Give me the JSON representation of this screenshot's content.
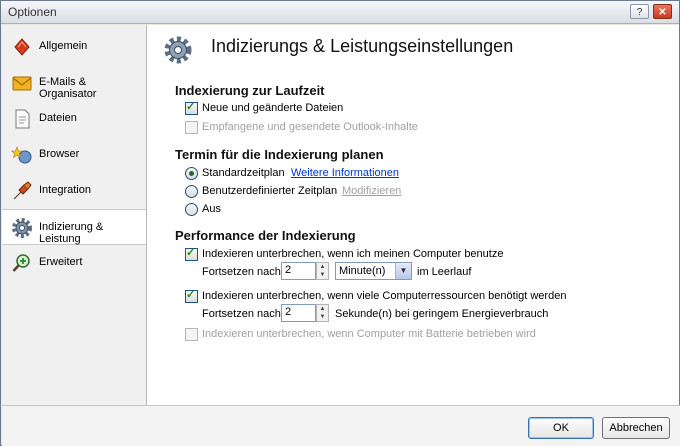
{
  "window": {
    "title": "Optionen",
    "help_label": "?",
    "close_label": "✕"
  },
  "sidebar": {
    "items": [
      {
        "label": "Allgemein",
        "icon": "general-icon",
        "active": false
      },
      {
        "label": "E-Mails & Organisator",
        "icon": "mail-icon",
        "active": false
      },
      {
        "label": "Dateien",
        "icon": "file-icon",
        "active": false
      },
      {
        "label": "Browser",
        "icon": "browser-icon",
        "active": false
      },
      {
        "label": "Integration",
        "icon": "integration-icon",
        "active": false
      },
      {
        "label": "Indizierung & Leistung",
        "icon": "gear-icon",
        "active": true
      },
      {
        "label": "Erweitert",
        "icon": "search-plus-icon",
        "active": false
      }
    ]
  },
  "main": {
    "title": "Indizierungs & Leistungseinstellungen",
    "runtime": {
      "heading": "Indexierung zur Laufzeit",
      "new_files_label": "Neue und geänderte Dateien",
      "new_files_checked": true,
      "outlook_label": "Empfangene und gesendete Outlook-Inhalte",
      "outlook_checked": false
    },
    "schedule": {
      "heading": "Termin für die Indexierung planen",
      "standard_label": "Standardzeitplan",
      "more_info_link": "Weitere Informationen",
      "custom_label": "Benutzerdefinierter Zeitplan",
      "modify_link": "Modifizieren",
      "off_label": "Aus",
      "selected": "standard"
    },
    "performance": {
      "heading": "Performance der Indexierung",
      "pause_use_label": "Indexieren unterbrechen, wenn ich meinen Computer benutze",
      "pause_use_checked": true,
      "resume_label_1": "Fortsetzen nach",
      "resume_value_1": "2",
      "unit_1": "Minute(n)",
      "idle_label": "im Leerlauf",
      "pause_resources_label": "Indexieren unterbrechen, wenn viele Computerressourcen benötigt werden",
      "pause_resources_checked": true,
      "resume_label_2": "Fortsetzen nach",
      "resume_value_2": "2",
      "seconds_label": "Sekunde(n) bei geringem Energieverbrauch",
      "battery_label": "Indexieren unterbrechen, wenn Computer mit Batterie betrieben wird",
      "battery_checked": false
    }
  },
  "footer": {
    "ok_label": "OK",
    "cancel_label": "Abbrechen"
  },
  "colors": {
    "link": "#0033cc",
    "check": "#1e9020",
    "disabled_text": "#a0a0a0"
  }
}
